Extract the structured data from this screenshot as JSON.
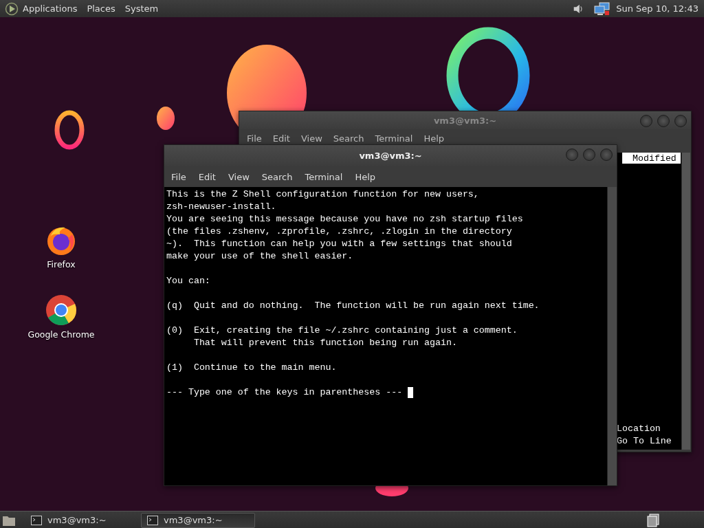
{
  "top_panel": {
    "menus": [
      "Applications",
      "Places",
      "System"
    ],
    "clock": "Sun Sep 10, 12:43"
  },
  "desktop_icons": [
    {
      "label": "Firefox",
      "kind": "firefox"
    },
    {
      "label": "Google Chrome",
      "kind": "chrome"
    }
  ],
  "back_window": {
    "title": "vm3@vm3:~",
    "menus": [
      "File",
      "Edit",
      "View",
      "Search",
      "Terminal",
      "Help"
    ],
    "status": "Modified",
    "shortcuts": [
      "Location",
      "Go To Line"
    ]
  },
  "front_window": {
    "title": "vm3@vm3:~",
    "menus": [
      "File",
      "Edit",
      "View",
      "Search",
      "Terminal",
      "Help"
    ],
    "paragraphs": [
      [
        "This is the Z Shell configuration function for new users,",
        "zsh-newuser-install.",
        "You are seeing this message because you have no zsh startup files",
        "(the files .zshenv, .zprofile, .zshrc, .zlogin in the directory",
        "~).  This function can help you with a few settings that should",
        "make your use of the shell easier."
      ],
      [
        "You can:"
      ],
      [
        "(q)  Quit and do nothing.  The function will be run again next time."
      ],
      [
        "(0)  Exit, creating the file ~/.zshrc containing just a comment.",
        "     That will prevent this function being run again."
      ],
      [
        "(1)  Continue to the main menu."
      ]
    ],
    "prompt": "--- Type one of the keys in parentheses ---"
  },
  "taskbar": [
    {
      "label": "vm3@vm3:~",
      "selected": false
    },
    {
      "label": "vm3@vm3:~",
      "selected": true
    }
  ]
}
